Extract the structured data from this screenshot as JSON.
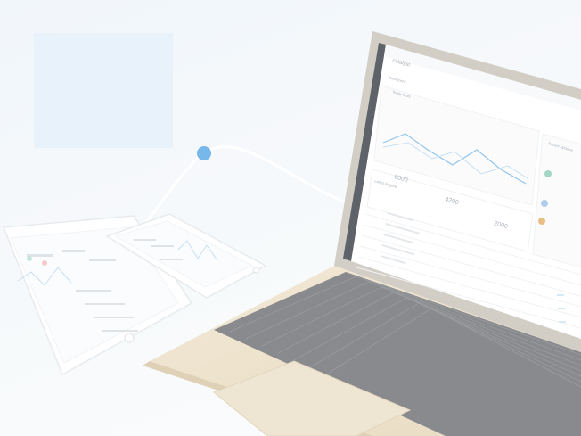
{
  "app": {
    "brand": "catalyst",
    "page_title": "Dashboard",
    "chart_title": "Yearly Stats",
    "sidebar_title": "Recent Updates",
    "table_title": "Latest Projects",
    "stats": [
      {
        "value": "6000"
      },
      {
        "value": "4200"
      },
      {
        "value": "2000"
      }
    ]
  },
  "colors": {
    "accent": "#5aa9e6",
    "laptop_body": "#e9dcc2",
    "keyboard": "#6d6f73",
    "screen_bg": "#ffffff",
    "sidebar": "#3b4048"
  }
}
